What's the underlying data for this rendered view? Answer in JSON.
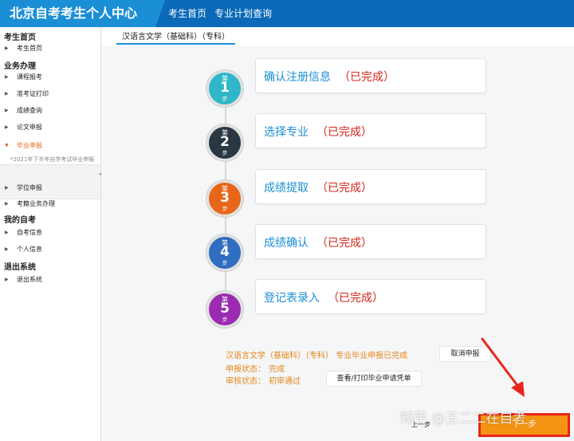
{
  "header": {
    "title": "北京自考考生个人中心",
    "nav": [
      "考生首页",
      "专业计划查询"
    ],
    "colors": {
      "bar": "#0a69b8",
      "brand": "#1b8fd6"
    }
  },
  "sidebar": {
    "sections": [
      {
        "title": "考生首页",
        "items": [
          "考生首页"
        ]
      },
      {
        "title": "业务办理",
        "items": [
          "课程报考",
          "准考证打印",
          "成绩查询",
          "论文申报",
          "毕业申报",
          "学位申报",
          "考籍业务办理"
        ]
      },
      {
        "title": "我的自考",
        "items": [
          "自考信息",
          "个人信息"
        ]
      },
      {
        "title": "退出系统",
        "items": [
          "退出系统"
        ]
      }
    ],
    "active_item": "毕业申报",
    "active_subtext": "*2021年下半年自学考试毕业申报"
  },
  "tab": {
    "label": "汉语言文学（基础科）（专科）"
  },
  "steps": [
    {
      "pre": "第",
      "num": "1",
      "post": "步",
      "title": "确认注册信息",
      "status": "（已完成）",
      "color": "#2fb7c9"
    },
    {
      "pre": "第",
      "num": "2",
      "post": "步",
      "title": "选择专业",
      "status": "（已完成）",
      "color": "#2a3642"
    },
    {
      "pre": "第",
      "num": "3",
      "post": "步",
      "title": "成绩提取",
      "status": "（已完成）",
      "color": "#e8661a"
    },
    {
      "pre": "第",
      "num": "4",
      "post": "步",
      "title": "成绩确认",
      "status": "（已完成）",
      "color": "#2f6ec0"
    },
    {
      "pre": "第",
      "num": "5",
      "post": "步",
      "title": "登记表录入",
      "status": "（已完成）",
      "color": "#9b2bb0"
    }
  ],
  "summary": {
    "line1": "汉语言文学（基础科）（专科） 专业毕业申报已完成",
    "cancel_label": "取消申报",
    "apply_status_label": "申报状态：",
    "apply_status_value": "完成",
    "review_status_label": "审核状态：",
    "review_status_value": "初审通过",
    "print_label": "查看/打印毕业申请凭单"
  },
  "footer": {
    "prev_label": "上一步",
    "next_label": "下一步",
    "watermark": "知乎 @王二二在自考"
  }
}
